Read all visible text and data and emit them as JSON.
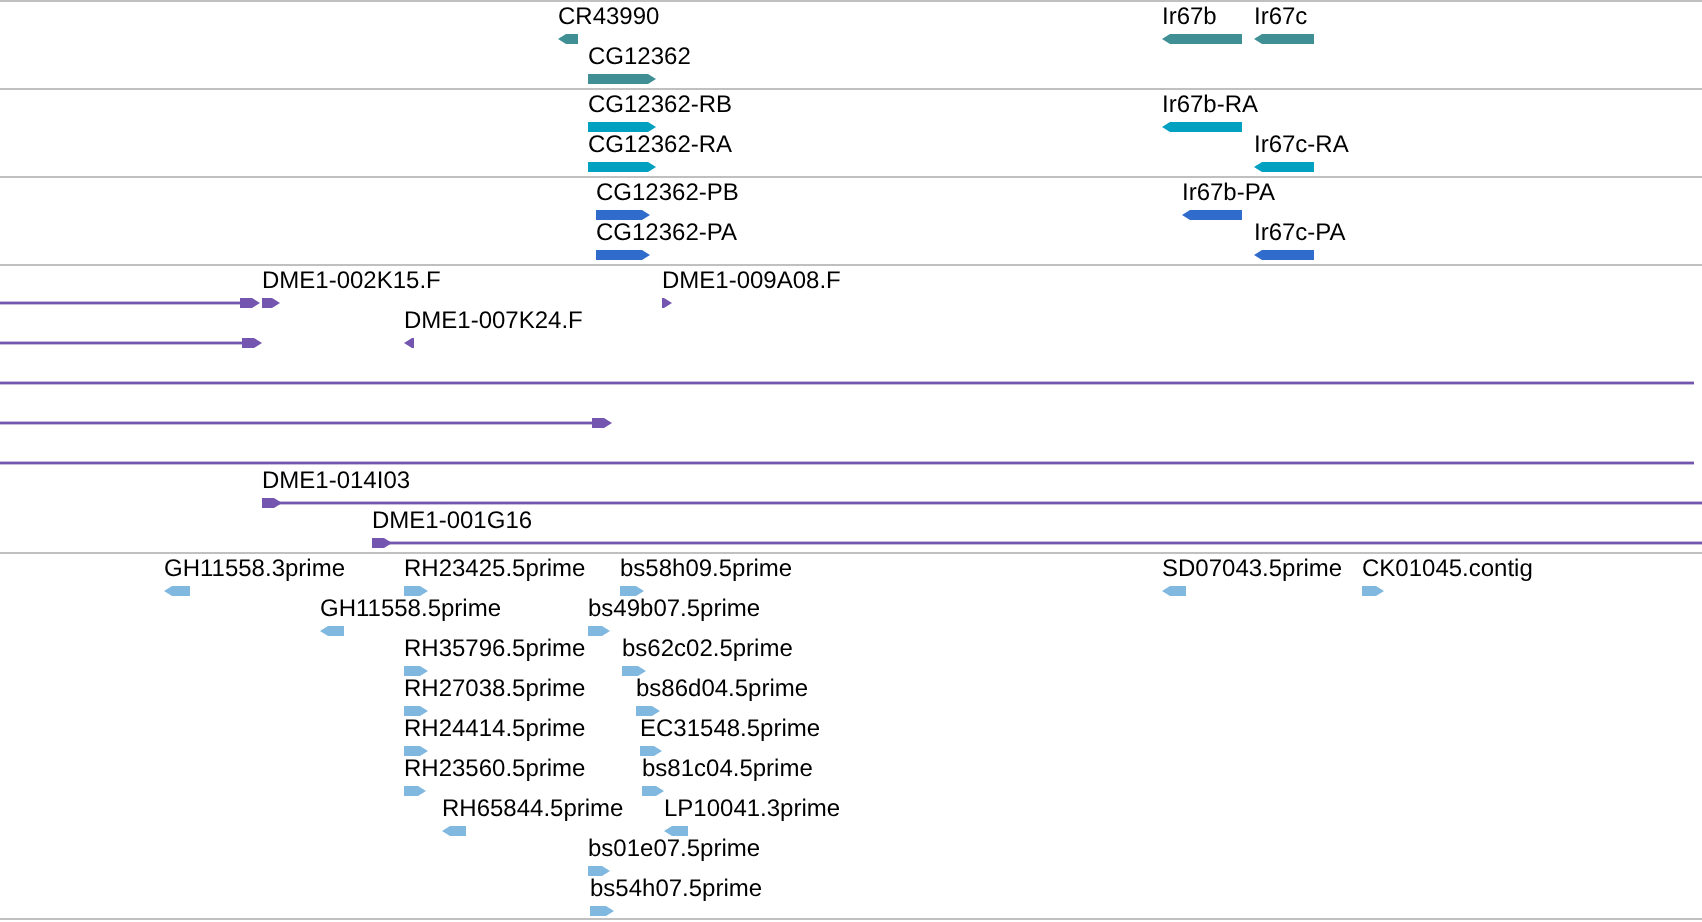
{
  "tracks": [
    {
      "color": "#3f8f94",
      "features": [
        {
          "label": "CR43990",
          "reverse": true
        },
        {
          "label": "CG12362",
          "reverse": false
        },
        {
          "label": "Ir67b",
          "reverse": true
        },
        {
          "label": "Ir67c",
          "reverse": true
        }
      ]
    },
    {
      "color": "#00a0c0",
      "features": [
        {
          "label": "CG12362-RB",
          "reverse": false
        },
        {
          "label": "CG12362-RA",
          "reverse": false
        },
        {
          "label": "Ir67b-RA",
          "reverse": true
        },
        {
          "label": "Ir67c-RA",
          "reverse": true
        }
      ]
    },
    {
      "color": "#306ccc",
      "features": [
        {
          "label": "CG12362-PB",
          "reverse": false
        },
        {
          "label": "CG12362-PA",
          "reverse": false
        },
        {
          "label": "Ir67b-PA",
          "reverse": true
        },
        {
          "label": "Ir67c-PA",
          "reverse": true
        }
      ]
    },
    {
      "color": "#7456b0",
      "features": [
        {
          "kind": "line",
          "reverse": false
        },
        {
          "kind": "block",
          "label": "DME1-002K15.F",
          "reverse": false
        },
        {
          "kind": "block",
          "label": "DME1-009A08.F",
          "reverse": false
        },
        {
          "kind": "line",
          "reverse": false
        },
        {
          "kind": "block",
          "label": "DME1-007K24.F",
          "reverse": true
        },
        {
          "kind": "bar"
        },
        {
          "kind": "line",
          "reverse": false
        },
        {
          "kind": "bar"
        },
        {
          "kind": "line",
          "label": "DME1-014I03",
          "reverse": false
        },
        {
          "kind": "line",
          "label": "DME1-001G16",
          "reverse": false
        }
      ]
    },
    {
      "color": "#80b8e0",
      "features": [
        {
          "label": "GH11558.3prime",
          "reverse": true
        },
        {
          "label": "RH23425.5prime",
          "reverse": false
        },
        {
          "label": "bs58h09.5prime",
          "reverse": false
        },
        {
          "label": "SD07043.5prime",
          "reverse": true
        },
        {
          "label": "CK01045.contig",
          "reverse": false
        },
        {
          "label": "GH11558.5prime",
          "reverse": true
        },
        {
          "label": "bs49b07.5prime",
          "reverse": false
        },
        {
          "label": "RH35796.5prime",
          "reverse": false
        },
        {
          "label": "bs62c02.5prime",
          "reverse": false
        },
        {
          "label": "RH27038.5prime",
          "reverse": false
        },
        {
          "label": "bs86d04.5prime",
          "reverse": false
        },
        {
          "label": "RH24414.5prime",
          "reverse": false
        },
        {
          "label": "EC31548.5prime",
          "reverse": false
        },
        {
          "label": "RH23560.5prime",
          "reverse": false
        },
        {
          "label": "bs81c04.5prime",
          "reverse": false
        },
        {
          "label": "RH65844.5prime",
          "reverse": true
        },
        {
          "label": "LP10041.3prime",
          "reverse": true
        },
        {
          "label": "bs01e07.5prime",
          "reverse": false
        },
        {
          "label": "bs54h07.5prime",
          "reverse": false
        }
      ]
    }
  ]
}
